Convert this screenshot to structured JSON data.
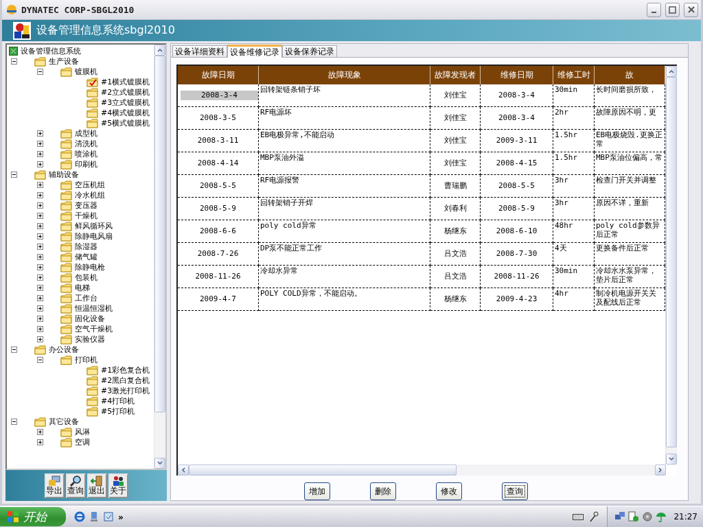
{
  "window": {
    "title": "DYNATEC CORP-SBGL2010"
  },
  "header": {
    "title": "设备管理信息系统sbgl2010"
  },
  "tree": {
    "root": "设备管理信息系统",
    "children": [
      {
        "label": "生产设备",
        "expanded": true,
        "children": [
          {
            "label": "镀膜机",
            "expanded": true,
            "children": [
              {
                "label": "#1横式镀膜机",
                "selected": true
              },
              {
                "label": "#2立式镀膜机",
                "selected": false
              },
              {
                "label": "#3立式镀膜机",
                "selected": false
              },
              {
                "label": "#4横式镀膜机",
                "selected": false
              },
              {
                "label": "#5横式镀膜机",
                "selected": false
              }
            ]
          },
          {
            "label": "成型机",
            "expanded": false
          },
          {
            "label": "清洗机",
            "expanded": false
          },
          {
            "label": "喷涂机",
            "expanded": false
          },
          {
            "label": "印刷机",
            "expanded": false
          }
        ]
      },
      {
        "label": "辅助设备",
        "expanded": true,
        "children": [
          {
            "label": "空压机组",
            "expanded": false
          },
          {
            "label": "冷水机组",
            "expanded": false
          },
          {
            "label": "变压器",
            "expanded": false
          },
          {
            "label": "干燥机",
            "expanded": false
          },
          {
            "label": "鲜风循环风",
            "expanded": false
          },
          {
            "label": "除静电风扇",
            "expanded": false
          },
          {
            "label": "除湿器",
            "expanded": false
          },
          {
            "label": "储气罐",
            "expanded": false
          },
          {
            "label": "除静电枪",
            "expanded": false
          },
          {
            "label": "包装机",
            "expanded": false
          },
          {
            "label": "电梯",
            "expanded": false
          },
          {
            "label": "工作台",
            "expanded": false
          },
          {
            "label": "恒温恒湿机",
            "expanded": false
          },
          {
            "label": "固化设备",
            "expanded": false
          },
          {
            "label": "空气干燥机",
            "expanded": false
          },
          {
            "label": "实验仪器",
            "expanded": false
          }
        ]
      },
      {
        "label": "办公设备",
        "expanded": true,
        "children": [
          {
            "label": "打印机",
            "expanded": true,
            "children": [
              {
                "label": "#1彩色复合机"
              },
              {
                "label": "#2黑白复合机"
              },
              {
                "label": "#3激光打印机"
              },
              {
                "label": "#4打印机"
              },
              {
                "label": "#5打印机"
              }
            ]
          }
        ]
      },
      {
        "label": "其它设备",
        "expanded": true,
        "children": [
          {
            "label": "风淋",
            "expanded": false
          },
          {
            "label": "空调",
            "expanded": false
          }
        ]
      }
    ]
  },
  "toolbar": [
    {
      "kind": "export",
      "label": "导出"
    },
    {
      "kind": "search",
      "label": "查询"
    },
    {
      "kind": "exit",
      "label": "退出"
    },
    {
      "kind": "about",
      "label": "关于"
    }
  ],
  "tabs": [
    {
      "label": "设备详细资料",
      "selected": false
    },
    {
      "label": "设备维修记录",
      "selected": true
    },
    {
      "label": "设备保养记录",
      "selected": false
    }
  ],
  "table": {
    "columns": [
      "故障日期",
      "故障现象",
      "故障发现者",
      "维修日期",
      "维修工时",
      "故"
    ],
    "rows": [
      {
        "selected": true,
        "cells": [
          "2008-3-4",
          "回转架链条销子坏",
          "刘佳宝",
          "2008-3-4",
          "30min",
          "长时间磨损所致，"
        ]
      },
      {
        "selected": false,
        "cells": [
          "2008-3-5",
          "RF电源坏",
          "刘佳宝",
          "2008-3-4",
          "2hr",
          "故障原因不明，更"
        ]
      },
      {
        "selected": false,
        "cells": [
          "2008-3-11",
          "EB电极异常,不能启动",
          "刘佳宝",
          "2009-3-11",
          "1.5hr",
          "EB电极烧毁.更换正常"
        ]
      },
      {
        "selected": false,
        "cells": [
          "2008-4-14",
          "MBP泵油外溢",
          "刘佳宝",
          "2008-4-15",
          "1.5hr",
          "MBP泵油位偏高，常"
        ]
      },
      {
        "selected": false,
        "cells": [
          "2008-5-5",
          "RF电源报警",
          "曹瑞鹏",
          "2008-5-5",
          "3hr",
          "检查门开关并调整"
        ]
      },
      {
        "selected": false,
        "cells": [
          "2008-5-9",
          "回转架销子开焊",
          "刘春利",
          "2008-5-9",
          "3hr",
          "原因不详，重新"
        ]
      },
      {
        "selected": false,
        "cells": [
          "2008-6-6",
          "poly cold异常",
          "杨继东",
          "2008-6-10",
          "48hr",
          "poly cold参数异后正常"
        ]
      },
      {
        "selected": false,
        "cells": [
          "2008-7-26",
          "DP泵不能正常工作",
          "吕文浩",
          "2008-7-30",
          "4天",
          "更换备件后正常"
        ]
      },
      {
        "selected": false,
        "cells": [
          "2008-11-26",
          "冷却水异常",
          "吕文浩",
          "2008-11-26",
          "30min",
          "冷却水水泵异常，垫片后正常"
        ]
      },
      {
        "selected": false,
        "cells": [
          "2009-4-7",
          "POLY COLD异常，不能启动。",
          "杨继东",
          "2009-4-23",
          "4hr",
          "制冷机电源开关关及配线后正常"
        ]
      }
    ]
  },
  "buttons": [
    "增加",
    "删除",
    "修改",
    "查询"
  ],
  "taskbar": {
    "start": "开始",
    "more": "»",
    "time": "21:27"
  }
}
